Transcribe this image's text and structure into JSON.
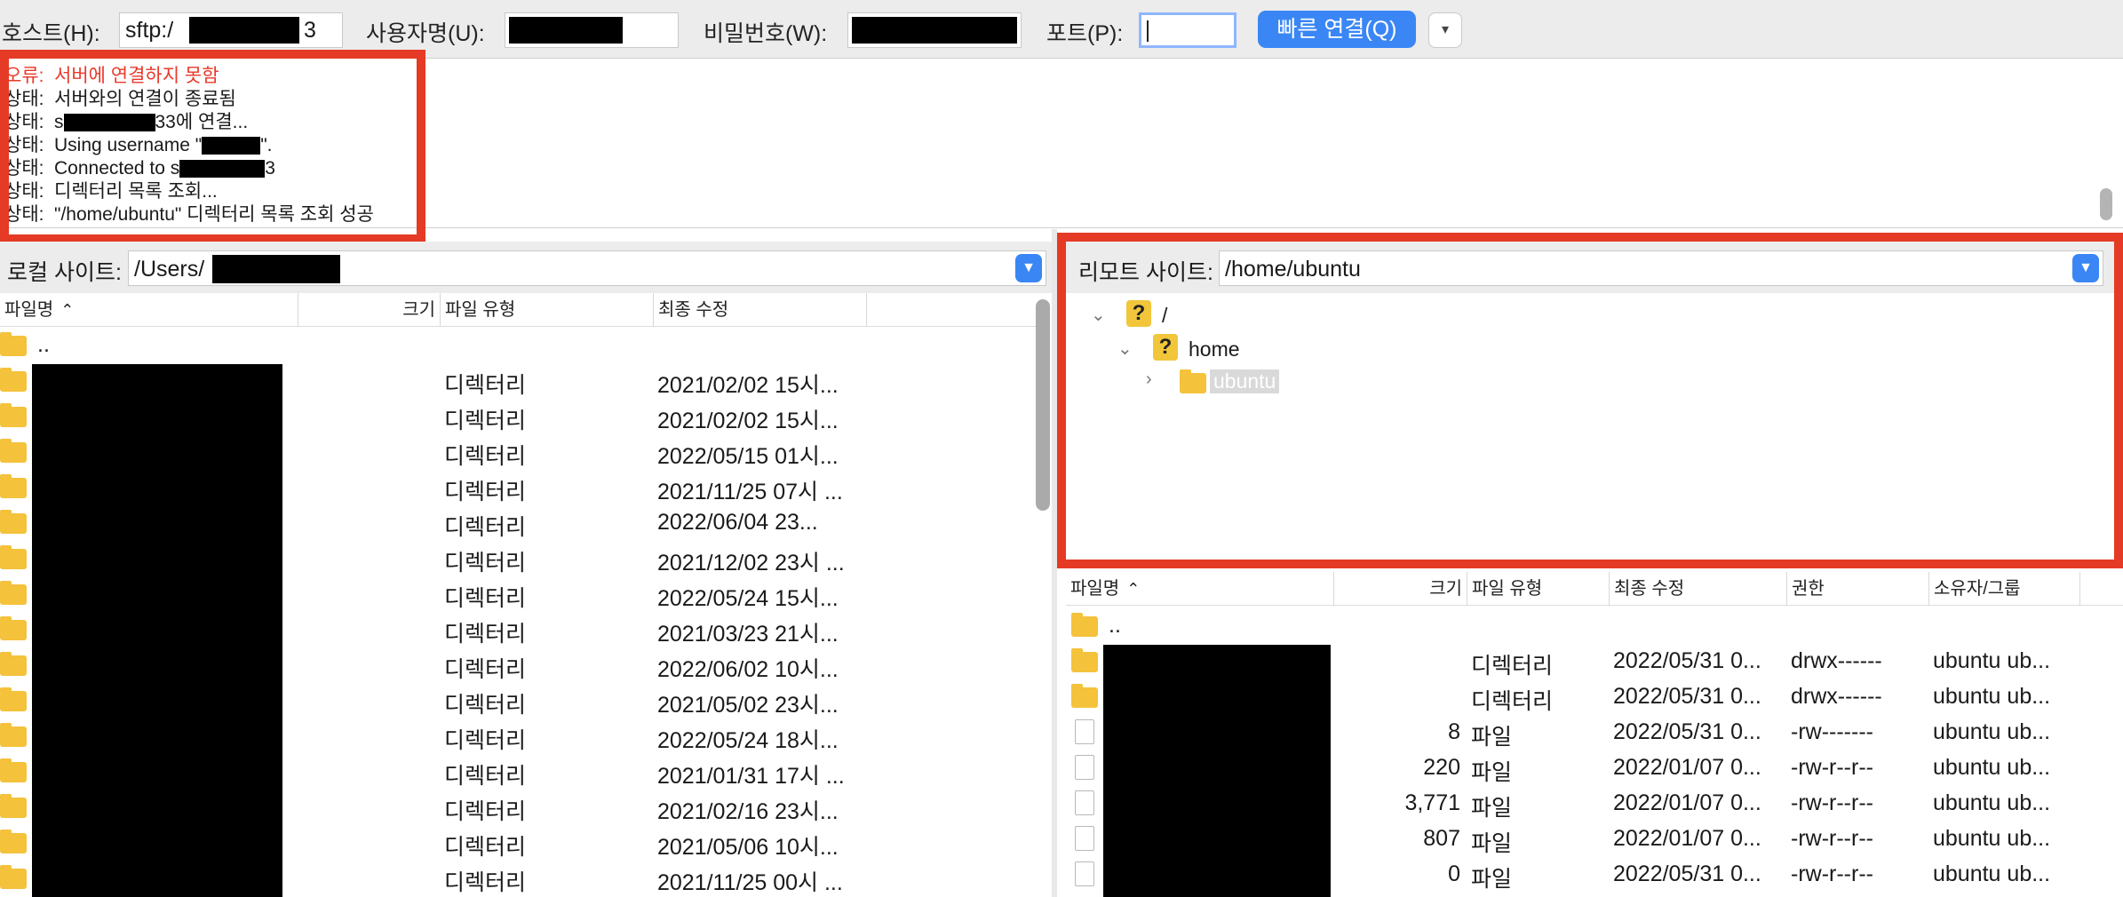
{
  "quickconnect": {
    "host_label": "호스트(H):",
    "host_value_start": "sftp:/",
    "host_value_end": "3",
    "user_label": "사용자명(U):",
    "password_label": "비밀번호(W):",
    "port_label": "포트(P):",
    "port_value": "",
    "connect_button": "빠른 연결(Q)",
    "dropdown_glyph": "▾"
  },
  "log": {
    "lines": [
      {
        "prefix": "오류:",
        "text": "서버에 연결하지 못함",
        "error": true
      },
      {
        "prefix": "상태:",
        "text": "서버와의 연결이 종료됨"
      },
      {
        "prefix": "상태:",
        "text": "s",
        "text2": "33에 연결..."
      },
      {
        "prefix": "상태:",
        "text": "Using username \"",
        "text2": "\"."
      },
      {
        "prefix": "상태:",
        "text": "Connected to s",
        "text2": "3"
      },
      {
        "prefix": "상태:",
        "text": "디렉터리 목록 조회..."
      },
      {
        "prefix": "상태:",
        "text": "\"/home/ubuntu\" 디렉터리 목록 조회 성공"
      }
    ]
  },
  "local": {
    "site_label": "로컬 사이트:",
    "path_prefix": "/Users/",
    "headers": {
      "name": "파일명",
      "size": "크기",
      "type": "파일 유형",
      "modified": "최종 수정"
    },
    "sort_glyph": "⌃",
    "parent_dir": "..",
    "rows": [
      {
        "type": "디렉터리",
        "modified": "2021/02/02 15시..."
      },
      {
        "type": "디렉터리",
        "modified": "2021/02/02 15시..."
      },
      {
        "type": "디렉터리",
        "modified": "2022/05/15 01시..."
      },
      {
        "type": "디렉터리",
        "modified": "2021/11/25 07시 ..."
      },
      {
        "type": "디렉터리",
        "modified": "2022/06/04 23..."
      },
      {
        "type": "디렉터리",
        "modified": "2021/12/02 23시 ..."
      },
      {
        "type": "디렉터리",
        "modified": "2022/05/24 15시..."
      },
      {
        "type": "디렉터리",
        "modified": "2021/03/23 21시..."
      },
      {
        "type": "디렉터리",
        "modified": "2022/06/02 10시..."
      },
      {
        "type": "디렉터리",
        "modified": "2021/05/02 23시..."
      },
      {
        "type": "디렉터리",
        "modified": "2022/05/24 18시..."
      },
      {
        "type": "디렉터리",
        "modified": "2021/01/31 17시 ..."
      },
      {
        "type": "디렉터리",
        "modified": "2021/02/16 23시..."
      },
      {
        "type": "디렉터리",
        "modified": "2021/05/06 10시..."
      },
      {
        "type": "디렉터리",
        "modified": "2021/11/25 00시 ..."
      }
    ]
  },
  "remote": {
    "site_label": "리모트 사이트:",
    "path": "/home/ubuntu",
    "tree": {
      "root": "/",
      "home": "home",
      "ubuntu": "ubuntu"
    },
    "headers": {
      "name": "파일명",
      "size": "크기",
      "type": "파일 유형",
      "modified": "최종 수정",
      "perms": "권한",
      "owner": "소유자/그룹"
    },
    "parent_dir": "..",
    "rows": [
      {
        "icon": "folder",
        "size": "",
        "type": "디렉터리",
        "modified": "2022/05/31 0...",
        "perms": "drwx------",
        "owner": "ubuntu ub..."
      },
      {
        "icon": "folder",
        "size": "",
        "type": "디렉터리",
        "modified": "2022/05/31 0...",
        "perms": "drwx------",
        "owner": "ubuntu ub..."
      },
      {
        "icon": "file",
        "size": "8",
        "type": "파일",
        "modified": "2022/05/31 0...",
        "perms": "-rw-------",
        "owner": "ubuntu ub..."
      },
      {
        "icon": "file",
        "size": "220",
        "type": "파일",
        "modified": "2022/01/07 0...",
        "perms": "-rw-r--r--",
        "owner": "ubuntu ub..."
      },
      {
        "icon": "file",
        "size": "3,771",
        "type": "파일",
        "modified": "2022/01/07 0...",
        "perms": "-rw-r--r--",
        "owner": "ubuntu ub..."
      },
      {
        "icon": "file",
        "size": "807",
        "type": "파일",
        "modified": "2022/01/07 0...",
        "perms": "-rw-r--r--",
        "owner": "ubuntu ub..."
      },
      {
        "icon": "file",
        "size": "0",
        "type": "파일",
        "modified": "2022/05/31 0...",
        "perms": "-rw-r--r--",
        "owner": "ubuntu ub..."
      }
    ]
  },
  "colors": {
    "accent": "#3a86f5",
    "highlight_box": "#e53a25",
    "error_text": "#e8392a",
    "folder": "#f4c23b"
  }
}
